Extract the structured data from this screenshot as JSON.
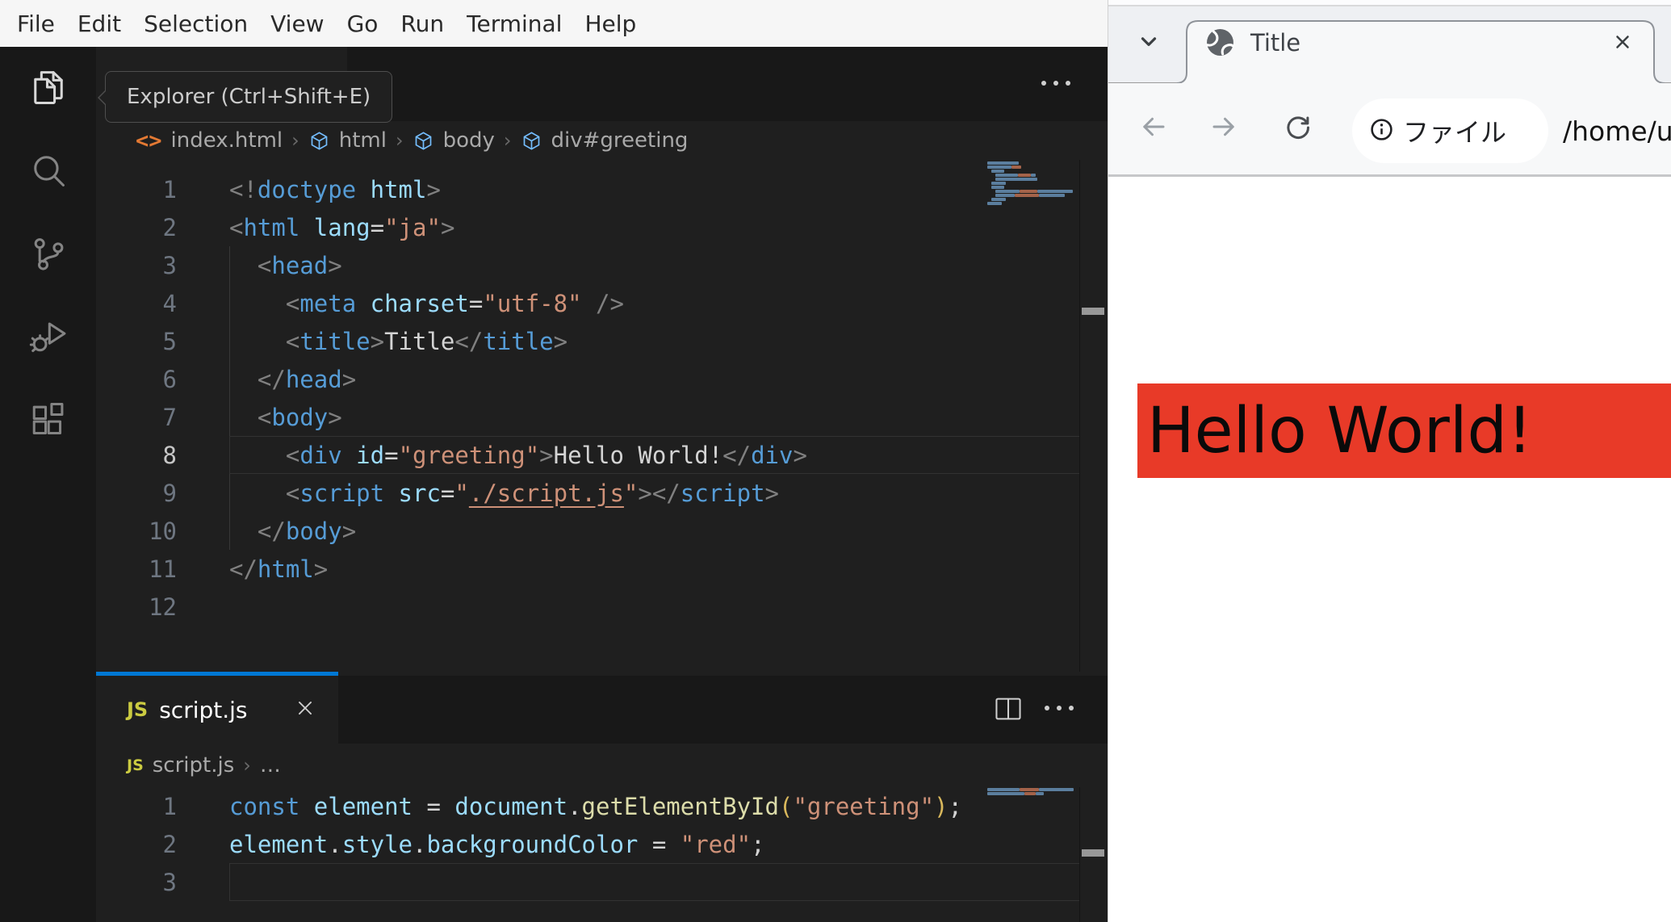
{
  "vscode": {
    "menu_bar": {
      "items": [
        "File",
        "Edit",
        "Selection",
        "View",
        "Go",
        "Run",
        "Terminal",
        "Help"
      ]
    },
    "activity_bar": {
      "tooltip": "Explorer (Ctrl+Shift+E)",
      "items": [
        {
          "icon": "files-icon",
          "active": true
        },
        {
          "icon": "search-icon",
          "active": false
        },
        {
          "icon": "source-control-icon",
          "active": false
        },
        {
          "icon": "run-debug-icon",
          "active": false
        },
        {
          "icon": "extensions-icon",
          "active": false
        }
      ]
    },
    "editor": {
      "breadcrumbs": [
        {
          "icon": "code-file-icon",
          "label": "index.html"
        },
        {
          "icon": "symbol-cube-icon",
          "label": "html"
        },
        {
          "icon": "symbol-cube-icon",
          "label": "body"
        },
        {
          "icon": "symbol-cube-icon",
          "label": "div#greeting"
        }
      ],
      "active_line": 8,
      "lines": [
        {
          "num": 1,
          "segs": [
            [
              "punct",
              "<!"
            ],
            [
              "tag",
              "doctype"
            ],
            [
              "attr",
              " html"
            ],
            [
              "punct",
              ">"
            ]
          ]
        },
        {
          "num": 2,
          "segs": [
            [
              "punct",
              "<"
            ],
            [
              "tag",
              "html"
            ],
            [
              "attr",
              " lang"
            ],
            [
              "op",
              "="
            ],
            [
              "str",
              "\"ja\""
            ],
            [
              "punct",
              ">"
            ]
          ]
        },
        {
          "num": 3,
          "segs": [
            [
              "punct",
              "  <"
            ],
            [
              "tag",
              "head"
            ],
            [
              "punct",
              ">"
            ]
          ]
        },
        {
          "num": 4,
          "segs": [
            [
              "punct",
              "    <"
            ],
            [
              "tag",
              "meta"
            ],
            [
              "attr",
              " charset"
            ],
            [
              "op",
              "="
            ],
            [
              "str",
              "\"utf-8\""
            ],
            [
              "punct",
              " />"
            ]
          ]
        },
        {
          "num": 5,
          "segs": [
            [
              "punct",
              "    <"
            ],
            [
              "tag",
              "title"
            ],
            [
              "punct",
              ">"
            ],
            [
              "text",
              "Title"
            ],
            [
              "punct",
              "</"
            ],
            [
              "tag",
              "title"
            ],
            [
              "punct",
              ">"
            ]
          ]
        },
        {
          "num": 6,
          "segs": [
            [
              "punct",
              "  </"
            ],
            [
              "tag",
              "head"
            ],
            [
              "punct",
              ">"
            ]
          ]
        },
        {
          "num": 7,
          "segs": [
            [
              "punct",
              "  <"
            ],
            [
              "tag",
              "body"
            ],
            [
              "punct",
              ">"
            ]
          ]
        },
        {
          "num": 8,
          "segs": [
            [
              "punct",
              "    <"
            ],
            [
              "tag",
              "div"
            ],
            [
              "attr",
              " id"
            ],
            [
              "op",
              "="
            ],
            [
              "str",
              "\"greeting\""
            ],
            [
              "punct",
              ">"
            ],
            [
              "text",
              "Hello World!"
            ],
            [
              "punct",
              "</"
            ],
            [
              "tag",
              "div"
            ],
            [
              "punct",
              ">"
            ]
          ]
        },
        {
          "num": 9,
          "segs": [
            [
              "punct",
              "    <"
            ],
            [
              "tag",
              "script"
            ],
            [
              "attr",
              " src"
            ],
            [
              "op",
              "="
            ],
            [
              "str",
              "\""
            ],
            [
              "strlink",
              "./script.js"
            ],
            [
              "str",
              "\""
            ],
            [
              "punct",
              "></"
            ],
            [
              "tag",
              "script"
            ],
            [
              "punct",
              ">"
            ]
          ]
        },
        {
          "num": 10,
          "segs": [
            [
              "punct",
              "  </"
            ],
            [
              "tag",
              "body"
            ],
            [
              "punct",
              ">"
            ]
          ]
        },
        {
          "num": 11,
          "segs": [
            [
              "punct",
              "</"
            ],
            [
              "tag",
              "html"
            ],
            [
              "punct",
              ">"
            ]
          ]
        },
        {
          "num": 12,
          "segs": []
        }
      ],
      "minimap": [
        {
          "ind": 0,
          "segs": [
            [
              "b",
              39
            ]
          ]
        },
        {
          "ind": 0,
          "segs": [
            [
              "b",
              30
            ],
            [
              "o",
              12
            ]
          ]
        },
        {
          "ind": 2,
          "segs": [
            [
              "b",
              16
            ]
          ]
        },
        {
          "ind": 4,
          "segs": [
            [
              "b",
              28
            ],
            [
              "o",
              16
            ],
            [
              "b",
              6
            ]
          ]
        },
        {
          "ind": 4,
          "segs": [
            [
              "b",
              52
            ]
          ]
        },
        {
          "ind": 2,
          "segs": [
            [
              "b",
              18
            ]
          ]
        },
        {
          "ind": 2,
          "segs": [
            [
              "b",
              16
            ]
          ]
        },
        {
          "ind": 4,
          "segs": [
            [
              "b",
              30
            ],
            [
              "o",
              22
            ],
            [
              "b",
              44
            ]
          ]
        },
        {
          "ind": 4,
          "segs": [
            [
              "b",
              24
            ],
            [
              "o",
              30
            ],
            [
              "b",
              32
            ]
          ]
        },
        {
          "ind": 2,
          "segs": [
            [
              "b",
              18
            ]
          ]
        },
        {
          "ind": 0,
          "segs": [
            [
              "b",
              18
            ]
          ]
        }
      ]
    },
    "panel": {
      "tab": {
        "icon": "js-icon",
        "label": "script.js"
      },
      "breadcrumbs": [
        {
          "icon": "js-icon",
          "label": "script.js"
        },
        {
          "icon": null,
          "label": "…"
        }
      ],
      "active_line": 3,
      "lines": [
        {
          "num": 1,
          "segs": [
            [
              "kw",
              "const"
            ],
            [
              "var",
              " element "
            ],
            [
              "op",
              "= "
            ],
            [
              "var",
              "document"
            ],
            [
              "op",
              "."
            ],
            [
              "fn",
              "getElementById"
            ],
            [
              "paren",
              "("
            ],
            [
              "str",
              "\"greeting\""
            ],
            [
              "paren",
              ")"
            ],
            [
              "op",
              ";"
            ]
          ]
        },
        {
          "num": 2,
          "segs": [
            [
              "var",
              "element"
            ],
            [
              "op",
              "."
            ],
            [
              "var",
              "style"
            ],
            [
              "op",
              "."
            ],
            [
              "var",
              "backgroundColor"
            ],
            [
              "op",
              " = "
            ],
            [
              "str",
              "\"red\""
            ],
            [
              "op",
              ";"
            ]
          ]
        },
        {
          "num": 3,
          "segs": []
        }
      ],
      "minimap": [
        {
          "ind": 0,
          "segs": [
            [
              "b",
              40
            ],
            [
              "o",
              24
            ],
            [
              "b",
              43
            ]
          ]
        },
        {
          "ind": 0,
          "segs": [
            [
              "b",
              46
            ],
            [
              "o",
              14
            ],
            [
              "b",
              10
            ]
          ]
        }
      ]
    }
  },
  "browser": {
    "tab_title": "Title",
    "address": {
      "chip_label": "ファイル",
      "url": "/home/u"
    },
    "page": {
      "heading": "Hello World!"
    }
  },
  "colors": {
    "accent_blue": "#0078d4",
    "banner_red": "#e83a28",
    "js_badge_yellow": "#cbcb41",
    "tag_blue": "#569cd6",
    "attr_blue": "#9cdcfe",
    "string_orange": "#ce9178",
    "minimap_blue": "#5b7e9e",
    "minimap_orange": "#a4634a"
  }
}
